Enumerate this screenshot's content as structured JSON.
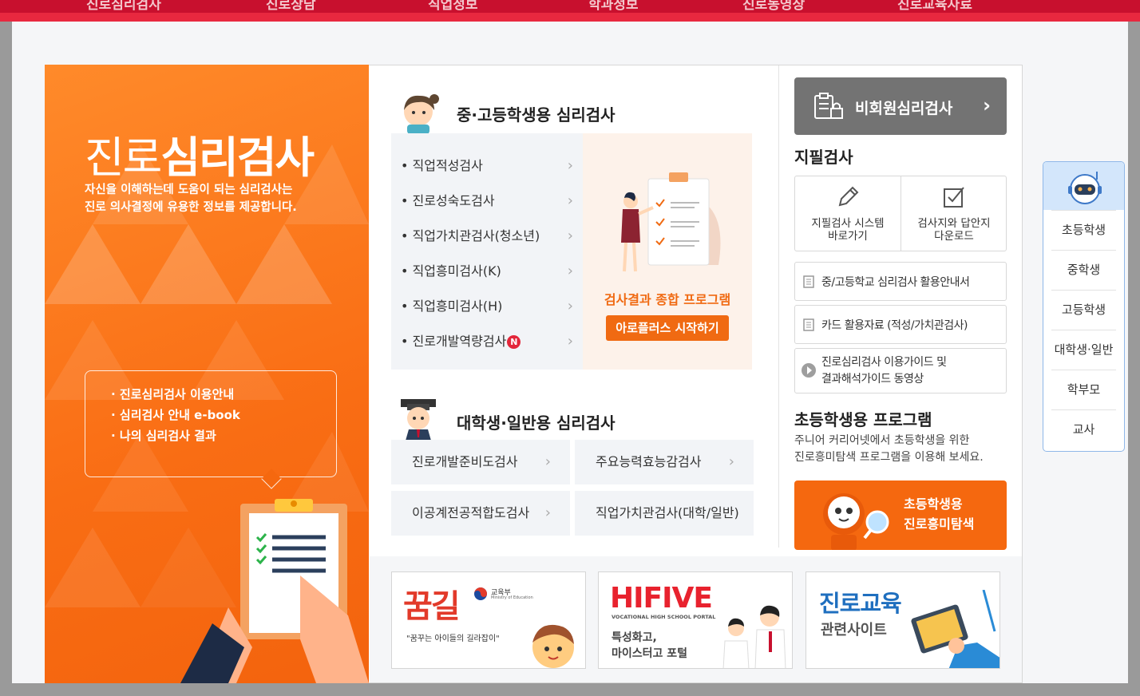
{
  "top_nav": [
    "진로심리검사",
    "진로상담",
    "직업정보",
    "학과정보",
    "진로동영상",
    "진로교육자료"
  ],
  "hero": {
    "title_light": "진로",
    "title_bold": "심리검사",
    "desc_line1": "자신을 이해하는데 도움이 되는 심리검사는",
    "desc_line2": "진로 의사결정에 유용한 정보를 제공합니다.",
    "links": [
      "· 진로심리검사 이용안내",
      "· 심리검사 안내 e-book",
      "· 나의 심리검사 결과"
    ]
  },
  "middle_high": {
    "title": "중·고등학생용 심리검사",
    "tests": [
      "• 직업적성검사",
      "• 진로성숙도검사",
      "• 직업가치관검사(청소년)",
      "• 직업흥미검사(K)",
      "• 직업흥미검사(H)",
      "• 진로개발역량검사"
    ],
    "new_badge": "N",
    "result_caption": "검사결과 종합 프로그램",
    "result_button": "아로플러스 시작하기"
  },
  "university": {
    "title": "대학생·일반용 심리검사",
    "tests": [
      "진로개발준비도검사",
      "주요능력효능감검사",
      "이공계전공적합도검사",
      "직업가치관검사(대학/일반)"
    ]
  },
  "right": {
    "nonmember_label": "비회원심리검사",
    "paper_title": "지필검사",
    "paper_system_line1": "지필검사 시스템",
    "paper_system_line2": "바로가기",
    "paper_download_line1": "검사지와 답안지",
    "paper_download_line2": "다운로드",
    "doc1": "중/고등학교 심리검사 활용안내서",
    "doc2": "카드 활용자료 (적성/가치관검사)",
    "video_line1": "진로심리검사 이용가이드 및",
    "video_line2": "결과해석가이드 동영상",
    "elem_title": "초등학생용 프로그램",
    "elem_desc_line1": "주니어 커리어넷에서 초등학생을 위한",
    "elem_desc_line2": "진로흥미탐색 프로그램을 이용해 보세요.",
    "elem_banner_line1": "초등학생용",
    "elem_banner_line2": "진로흥미탐색"
  },
  "banners": {
    "kumgil_title": "꿈길",
    "kumgil_ministry": "교육부",
    "kumgil_ministry_en": "Ministry of Education",
    "kumgil_slogan": "\"꿈꾸는 아이들의 길라잡이\"",
    "hifive_title": "HIFIVE",
    "hifive_sub": "VOCATIONAL HIGH SCHOOL PORTAL",
    "hifive_line1": "특성화고,",
    "hifive_line2": "마이스터고 포털",
    "career_title": "진로교육",
    "career_sub": "관련사이트"
  },
  "side_menu": [
    "초등학생",
    "중학생",
    "고등학생",
    "대학생·일반",
    "학부모",
    "교사"
  ],
  "colors": {
    "orange": "#f5680f",
    "red": "#c8102e",
    "gray_button": "#737373",
    "side_border": "#8fb7e8"
  }
}
